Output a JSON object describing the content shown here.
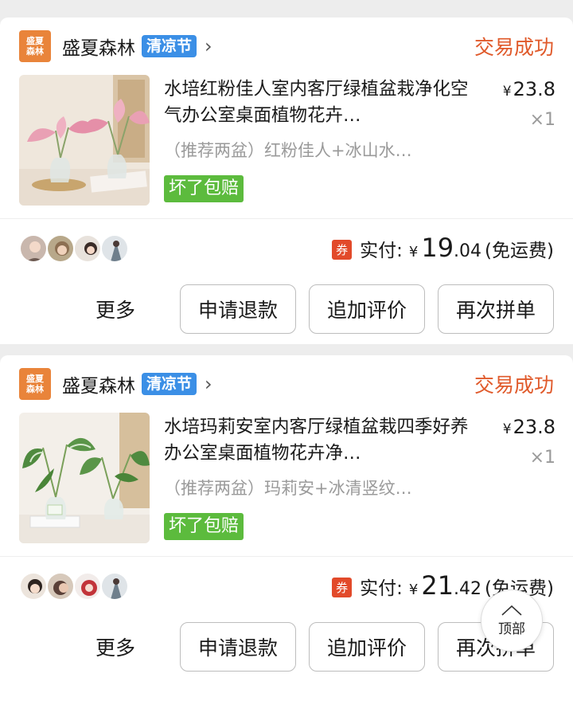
{
  "orders": [
    {
      "shop": {
        "logo_line1": "盛夏",
        "logo_line2": "森林",
        "name": "盛夏森林",
        "badge": "清凉节",
        "chevron": "›"
      },
      "status": "交易成功",
      "product": {
        "title": "水培红粉佳人室内客厅绿植盆栽净化空气办公室桌面植物花卉…",
        "spec": "（推荐两盆）红粉佳人+冰山水…",
        "price_symbol": "¥",
        "price": "23.8",
        "qty": "×1",
        "guarantee": "坏了包赔"
      },
      "avatar_icons": [
        "avatar-icon",
        "avatar-icon",
        "avatar-icon",
        "avatar-icon"
      ],
      "paid": {
        "coupon": "券",
        "label": "实付:",
        "symbol": "¥",
        "int": "19",
        "dec": ".04",
        "note": "(免运费)"
      },
      "actions": {
        "more": "更多",
        "refund": "申请退款",
        "review": "追加评价",
        "reorder": "再次拼单"
      }
    },
    {
      "shop": {
        "logo_line1": "盛夏",
        "logo_line2": "森林",
        "name": "盛夏森林",
        "badge": "清凉节",
        "chevron": "›"
      },
      "status": "交易成功",
      "product": {
        "title": "水培玛莉安室内客厅绿植盆栽四季好养办公室桌面植物花卉净…",
        "spec": "（推荐两盆）玛莉安+冰清竖纹…",
        "price_symbol": "¥",
        "price": "23.8",
        "qty": "×1",
        "guarantee": "坏了包赔"
      },
      "avatar_icons": [
        "avatar-icon",
        "avatar-icon",
        "avatar-icon",
        "avatar-icon"
      ],
      "paid": {
        "coupon": "券",
        "label": "实付:",
        "symbol": "¥",
        "int": "21",
        "dec": ".42",
        "note": "(免运费)"
      },
      "actions": {
        "more": "更多",
        "refund": "申请退款",
        "review": "追加评价",
        "reorder": "再次拼单"
      }
    }
  ],
  "back_to_top": {
    "label": "顶部",
    "icon": "arrow-up-icon"
  },
  "colors": {
    "status": "#e05a2b",
    "badge": "#3b8fe6",
    "guarantee": "#5cbb3d",
    "coupon": "#e24a2a",
    "logo": "#e9843a"
  }
}
